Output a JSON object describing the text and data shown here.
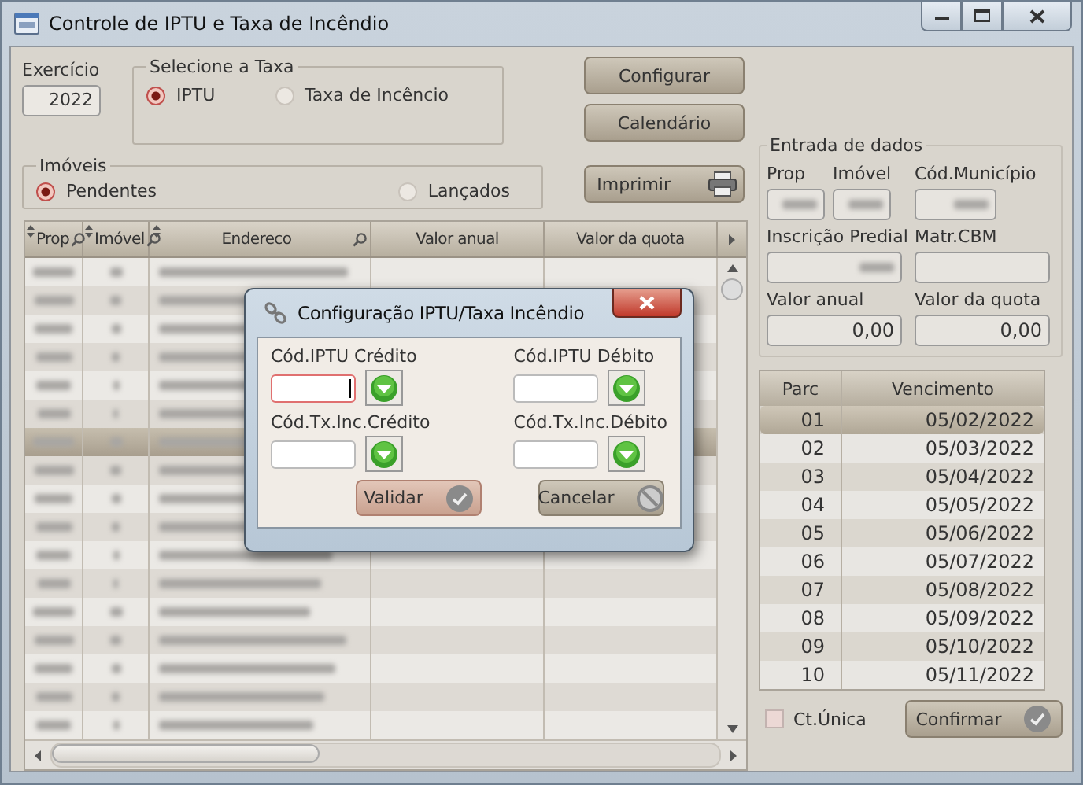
{
  "window": {
    "title": "Controle de IPTU e Taxa de Incêndio"
  },
  "exercicio": {
    "label": "Exercício",
    "value": "2022"
  },
  "taxa_group": {
    "title": "Selecione a Taxa",
    "options": [
      {
        "label": "IPTU",
        "selected": true
      },
      {
        "label": "Taxa de Incêncio",
        "selected": false
      }
    ]
  },
  "imoveis_group": {
    "title": "Imóveis",
    "options": [
      {
        "label": "Pendentes",
        "selected": true
      },
      {
        "label": "Lançados",
        "selected": false
      }
    ]
  },
  "buttons": [
    "Configurar",
    "Calendário"
  ],
  "print_button": "Imprimir",
  "table": {
    "columns": [
      {
        "label": "Prop",
        "kind": "filter"
      },
      {
        "label": "Imóvel",
        "kind": "filter"
      },
      {
        "label": "Endereco",
        "kind": "search"
      },
      {
        "label": "Valor anual",
        "kind": "plain"
      },
      {
        "label": "Valor da quota",
        "kind": "plain"
      }
    ],
    "rows": [
      {
        "selected": false
      },
      {
        "selected": false
      },
      {
        "selected": false
      },
      {
        "selected": false
      },
      {
        "selected": false
      },
      {
        "selected": false
      },
      {
        "selected": true
      },
      {
        "selected": false
      },
      {
        "selected": false
      },
      {
        "selected": false
      },
      {
        "selected": false
      },
      {
        "selected": false
      },
      {
        "selected": false
      },
      {
        "selected": false
      },
      {
        "selected": false
      },
      {
        "selected": false
      },
      {
        "selected": false
      }
    ]
  },
  "data_entry": {
    "title": "Entrada de dados",
    "fields": [
      {
        "label": "Prop",
        "kind": "redacted"
      },
      {
        "label": "Imóvel",
        "kind": "redacted"
      },
      {
        "label": "Cód.Município",
        "kind": "redacted"
      },
      {
        "label": "Inscrição Predial",
        "kind": "redacted"
      },
      {
        "label": "Matr.CBM",
        "kind": "text"
      },
      {
        "label": "Valor anual",
        "kind": "text",
        "value": "0,00"
      },
      {
        "label": "Valor da quota",
        "kind": "text",
        "value": "0,00"
      }
    ]
  },
  "installments": {
    "columns": [
      "Parc",
      "Vencimento"
    ],
    "rows": [
      {
        "parc": "01",
        "vencimento": "05/02/2022",
        "selected": true
      },
      {
        "parc": "02",
        "vencimento": "05/03/2022",
        "selected": false
      },
      {
        "parc": "03",
        "vencimento": "05/04/2022",
        "selected": false
      },
      {
        "parc": "04",
        "vencimento": "05/05/2022",
        "selected": false
      },
      {
        "parc": "05",
        "vencimento": "05/06/2022",
        "selected": false
      },
      {
        "parc": "06",
        "vencimento": "05/07/2022",
        "selected": false
      },
      {
        "parc": "07",
        "vencimento": "05/08/2022",
        "selected": false
      },
      {
        "parc": "08",
        "vencimento": "05/09/2022",
        "selected": false
      },
      {
        "parc": "09",
        "vencimento": "05/10/2022",
        "selected": false
      },
      {
        "parc": "10",
        "vencimento": "05/11/2022",
        "selected": false
      }
    ]
  },
  "ct_unica": {
    "label": "Ct.Única",
    "checked": false
  },
  "confirm_button": "Confirmar",
  "dialog": {
    "title": "Configuração IPTU/Taxa Incêndio",
    "fields": [
      {
        "label": "Cód.IPTU Crédito",
        "focused": true
      },
      {
        "label": "Cód.IPTU Débito",
        "focused": false
      },
      {
        "label": "Cód.Tx.Inc.Crédito",
        "focused": false
      },
      {
        "label": "Cód.Tx.Inc.Débito",
        "focused": false
      }
    ],
    "buttons": [
      {
        "label": "Validar",
        "kind": "validate"
      },
      {
        "label": "Cancelar",
        "kind": "cancel"
      }
    ]
  }
}
